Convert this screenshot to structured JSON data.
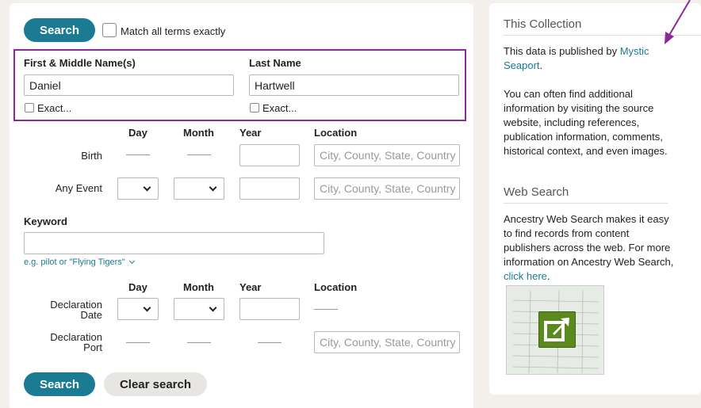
{
  "search_form": {
    "search_label": "Search",
    "match_exact_label": "Match all terms exactly",
    "first_name_label": "First & Middle Name(s)",
    "last_name_label": "Last Name",
    "first_name_value": "Daniel",
    "last_name_value": "Hartwell",
    "exact_label": "Exact...",
    "col_day": "Day",
    "col_month": "Month",
    "col_year": "Year",
    "col_location": "Location",
    "birth_label": "Birth",
    "any_event_label": "Any Event",
    "location_placeholder": "City, County, State, Country",
    "keyword_label": "Keyword",
    "keyword_hint": "e.g. pilot or \"Flying Tigers\"",
    "declaration_date_label_1": "Declaration",
    "declaration_date_label_2": "Date",
    "declaration_port_label_1": "Declaration",
    "declaration_port_label_2": "Port",
    "clear_label": "Clear search"
  },
  "sidebar": {
    "collection_heading": "This Collection",
    "published_prefix": "This data is published by ",
    "publisher_link_1": "Mystic",
    "publisher_link_2": "Seaport",
    "published_suffix": ".",
    "info_text": "You can often find additional information by visiting the source website, including references, publication information, comments, historical context, and even images.",
    "web_search_heading": "Web Search",
    "web_search_text": "Ancestry Web Search makes it easy to find records from content publishers across the web. For more information on Ancestry Web Search, ",
    "click_here": "click here",
    "click_here_suffix": "."
  },
  "colors": {
    "accent": "#1b7b94",
    "highlight": "#8a2a98",
    "icon_green": "#5a8a1e"
  },
  "icons": {
    "external_link": "external-link-icon",
    "chevron": "chevron-down-icon",
    "annotation": "arrow-annotation"
  }
}
